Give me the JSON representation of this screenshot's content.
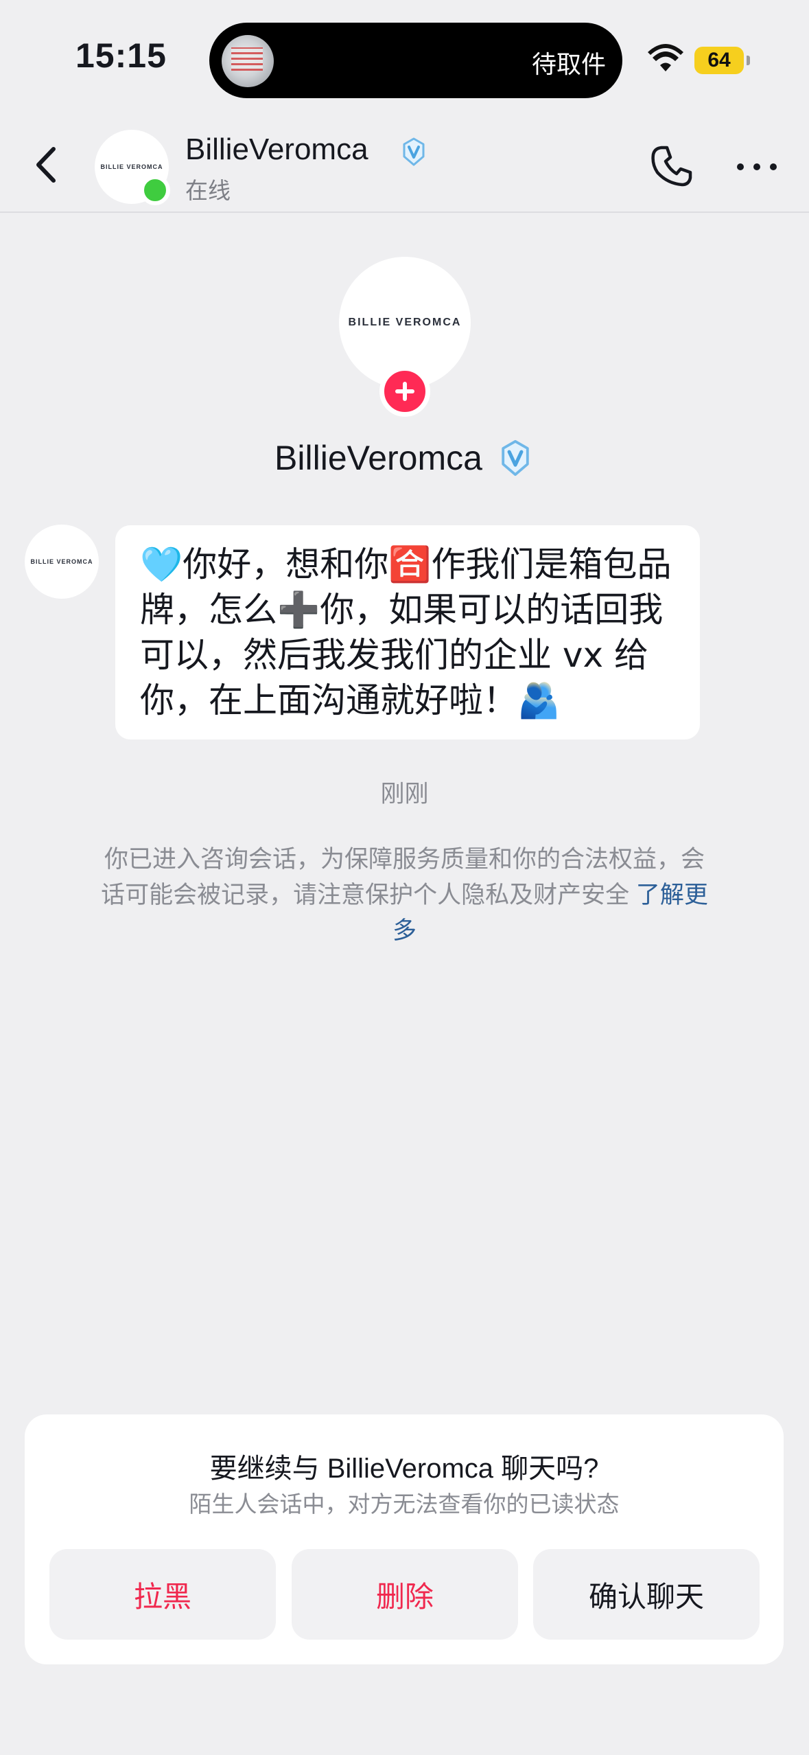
{
  "status_bar": {
    "time": "15:15",
    "live_activity_text": "待取件",
    "battery_level": "64",
    "battery_color": "#f6cf1e"
  },
  "header": {
    "contact_name": "BillieVeromca",
    "presence": "在线",
    "avatar_text": "BILLIE VEROMCA",
    "online_color": "#3fcc3f"
  },
  "profile": {
    "name": "BillieVeromca",
    "avatar_text": "BILLIE VEROMCA",
    "add_badge_color": "#ff2a55"
  },
  "messages": [
    {
      "sender_avatar_text": "BILLIE VEROMCA",
      "text": "🩵你好，想和你🈴作我们是箱包品牌，怎么➕你，如果可以的话回我可以，然后我发我们的企业 vx 给你，在上面沟通就好啦！🫂"
    }
  ],
  "conversation": {
    "timestamp": "刚刚",
    "notice": "你已进入咨询会话，为保障服务质量和你的合法权益，会话可能会被记录，请注意保护个人隐私及财产安全 ",
    "learn_more": "了解更多"
  },
  "prompt_card": {
    "title": "要继续与 BillieVeromca 聊天吗?",
    "subtitle": "陌生人会话中，对方无法查看你的已读状态",
    "buttons": {
      "block": "拉黑",
      "delete": "删除",
      "confirm": "确认聊天"
    },
    "danger_color": "#f0284e"
  },
  "icons": [
    "wifi-icon",
    "back-icon",
    "verified-icon",
    "phone-icon",
    "more-icon",
    "plus-icon"
  ]
}
